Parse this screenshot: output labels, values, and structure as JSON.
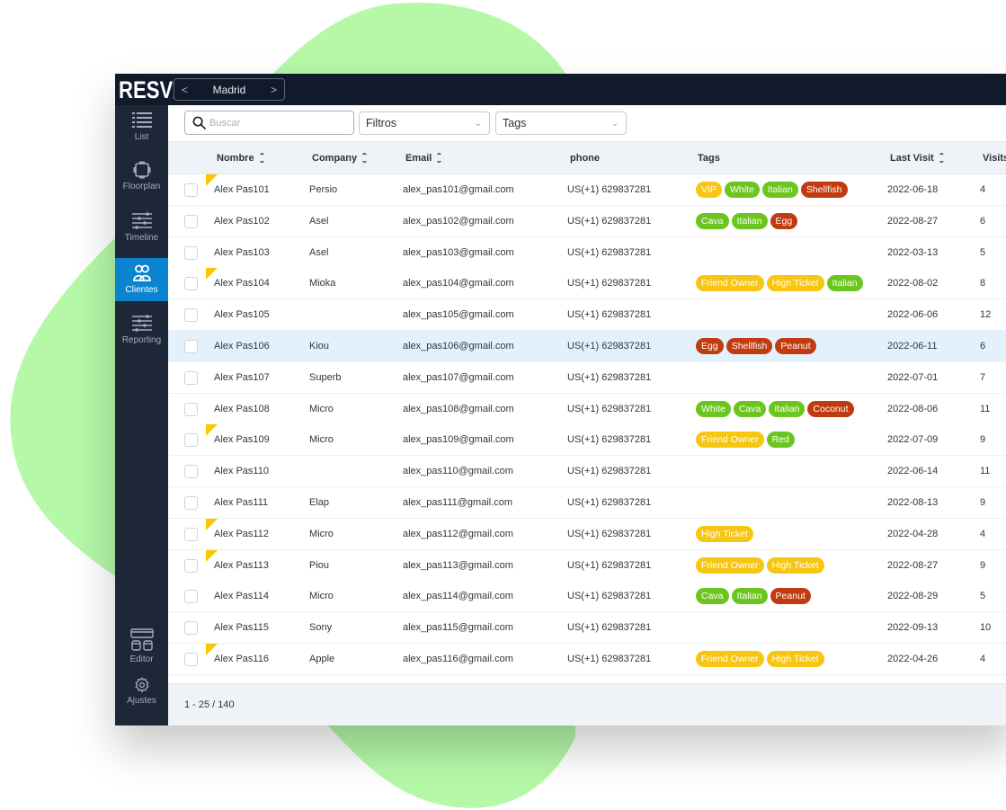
{
  "app": {
    "logo": "RESV",
    "location": "Madrid",
    "prev_label": "<",
    "next_label": ">"
  },
  "sidebar": {
    "items": [
      {
        "label": "List",
        "icon": "list-icon"
      },
      {
        "label": "Floorplan",
        "icon": "floorplan-icon"
      },
      {
        "label": "Timeline",
        "icon": "timeline-icon"
      },
      {
        "label": "Clientes",
        "icon": "clients-icon",
        "active": true
      },
      {
        "label": "Reporting",
        "icon": "reporting-icon"
      }
    ],
    "bottom_items": [
      {
        "label": "Editor",
        "icon": "editor-icon"
      },
      {
        "label": "Ajustes",
        "icon": "gear-icon"
      }
    ]
  },
  "toolbar": {
    "search_placeholder": "Buscar",
    "search_value": "",
    "filters_label": "Filtros",
    "tags_label": "Tags"
  },
  "table": {
    "columns": [
      {
        "key": "name",
        "label": "Nombre",
        "sortable": true
      },
      {
        "key": "company",
        "label": "Company",
        "sortable": true
      },
      {
        "key": "email",
        "label": "Email",
        "sortable": true
      },
      {
        "key": "phone",
        "label": "phone",
        "sortable": false
      },
      {
        "key": "tags",
        "label": "Tags",
        "sortable": false
      },
      {
        "key": "last_visit",
        "label": "Last Visit",
        "sortable": true
      },
      {
        "key": "visits",
        "label": "Visits",
        "sortable": false
      }
    ],
    "tag_colors": {
      "yellow": "#f7c613",
      "green": "#6cc51f",
      "red": "#c23a0f"
    },
    "tag_palette": {
      "VIP": "yellow",
      "Friend Owner": "yellow",
      "High Ticket": "yellow",
      "White": "green",
      "Italian": "green",
      "Cava": "green",
      "Red": "green",
      "Shellfish": "red",
      "Egg": "red",
      "Peanut": "red",
      "Coconut": "red"
    },
    "rows": [
      {
        "name": "Alex Pas101",
        "company": "Persio",
        "email": "alex_pas101@gmail.com",
        "phone": "US(+1) 629837281",
        "tags": [
          "VIP",
          "White",
          "Italian",
          "Shellfish"
        ],
        "last_visit": "2022-06-18",
        "visits": "4",
        "flag": true
      },
      {
        "name": "Alex Pas102",
        "company": "Asel",
        "email": "alex_pas102@gmail.com",
        "phone": "US(+1) 629837281",
        "tags": [
          "Cava",
          "Italian",
          "Egg"
        ],
        "last_visit": "2022-08-27",
        "visits": "6",
        "flag": false
      },
      {
        "name": "Alex Pas103",
        "company": "Asel",
        "email": "alex_pas103@gmail.com",
        "phone": "US(+1) 629837281",
        "tags": [],
        "last_visit": "2022-03-13",
        "visits": "5",
        "flag": false
      },
      {
        "name": "Alex Pas104",
        "company": "Mioka",
        "email": "alex_pas104@gmail.com",
        "phone": "US(+1) 629837281",
        "tags": [
          "Friend Owner",
          "High Ticket",
          "Italian"
        ],
        "last_visit": "2022-08-02",
        "visits": "8",
        "flag": true
      },
      {
        "name": "Alex Pas105",
        "company": "",
        "email": "alex_pas105@gmail.com",
        "phone": "US(+1) 629837281",
        "tags": [],
        "last_visit": "2022-06-06",
        "visits": "12",
        "flag": false
      },
      {
        "name": "Alex Pas106",
        "company": "Kiou",
        "email": "alex_pas106@gmail.com",
        "phone": "US(+1) 629837281",
        "tags": [
          "Egg",
          "Shellfish",
          "Peanut"
        ],
        "last_visit": "2022-06-11",
        "visits": "6",
        "flag": false,
        "highlighted": true
      },
      {
        "name": "Alex Pas107",
        "company": "Superb",
        "email": "alex_pas107@gmail.com",
        "phone": "US(+1) 629837281",
        "tags": [],
        "last_visit": "2022-07-01",
        "visits": "7",
        "flag": false
      },
      {
        "name": "Alex Pas108",
        "company": "Micro",
        "email": "alex_pas108@gmail.com",
        "phone": "US(+1) 629837281",
        "tags": [
          "White",
          "Cava",
          "Italian",
          "Coconut"
        ],
        "last_visit": "2022-08-06",
        "visits": "11",
        "flag": false
      },
      {
        "name": "Alex Pas109",
        "company": "Micro",
        "email": "alex_pas109@gmail.com",
        "phone": "US(+1) 629837281",
        "tags": [
          "Friend Owner",
          "Red"
        ],
        "last_visit": "2022-07-09",
        "visits": "9",
        "flag": true
      },
      {
        "name": "Alex Pas110",
        "company": "",
        "email": "alex_pas110@gmail.com",
        "phone": "US(+1) 629837281",
        "tags": [],
        "last_visit": "2022-06-14",
        "visits": "11",
        "flag": false
      },
      {
        "name": "Alex Pas111",
        "company": "Elap",
        "email": "alex_pas111@gmail.com",
        "phone": "US(+1) 629837281",
        "tags": [],
        "last_visit": "2022-08-13",
        "visits": "9",
        "flag": false
      },
      {
        "name": "Alex Pas112",
        "company": "Micro",
        "email": "alex_pas112@gmail.com",
        "phone": "US(+1) 629837281",
        "tags": [
          "High Ticket"
        ],
        "last_visit": "2022-04-28",
        "visits": "4",
        "flag": true
      },
      {
        "name": "Alex Pas113",
        "company": "Piou",
        "email": "alex_pas113@gmail.com",
        "phone": "US(+1) 629837281",
        "tags": [
          "Friend Owner",
          "High Ticket"
        ],
        "last_visit": "2022-08-27",
        "visits": "9",
        "flag": true
      },
      {
        "name": "Alex Pas114",
        "company": "Micro",
        "email": "alex_pas114@gmail.com",
        "phone": "US(+1) 629837281",
        "tags": [
          "Cava",
          "Italian",
          "Peanut"
        ],
        "last_visit": "2022-08-29",
        "visits": "5",
        "flag": false
      },
      {
        "name": "Alex Pas115",
        "company": "Sony",
        "email": "alex_pas115@gmail.com",
        "phone": "US(+1) 629837281",
        "tags": [],
        "last_visit": "2022-09-13",
        "visits": "10",
        "flag": false
      },
      {
        "name": "Alex Pas116",
        "company": "Apple",
        "email": "alex_pas116@gmail.com",
        "phone": "US(+1) 629837281",
        "tags": [
          "Friend Owner",
          "High Ticket"
        ],
        "last_visit": "2022-04-26",
        "visits": "4",
        "flag": true
      }
    ]
  },
  "footer": {
    "pagination": "1 - 25 / 140"
  },
  "colors": {
    "topbar": "#111a2b",
    "sidebar": "#1e2738",
    "active": "#0a84d0",
    "blob": "#b5f8a8",
    "row_highlight": "#e3f1fc",
    "flag": "#f8c800"
  }
}
